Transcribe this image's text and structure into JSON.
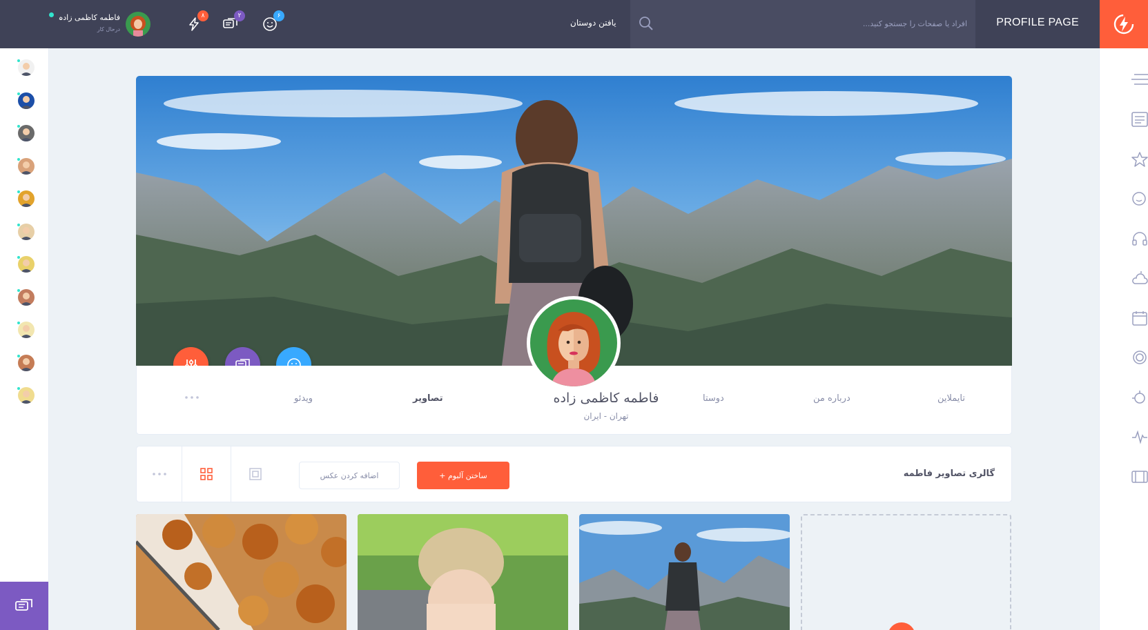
{
  "colors": {
    "topbar": "#3f4257",
    "accent": "#ff5e3a",
    "purple": "#7c5ac2",
    "blue": "#38a9ff",
    "green_online": "#32e4cd",
    "background": "#edf2f6"
  },
  "header": {
    "title": "PROFILE PAGE",
    "search_placeholder": "افراد یا صفحات را جستجو کنید...",
    "find_friends": "یافتن دوستان",
    "notifications": [
      {
        "icon": "smile-icon",
        "count": "۶"
      },
      {
        "icon": "chat-icon",
        "count": "۲"
      },
      {
        "icon": "thunder-icon",
        "count": "۸"
      }
    ],
    "user": {
      "name": "فاطمه کاظمی زاده",
      "status": "درحال کار"
    }
  },
  "profile": {
    "name": "فاطمه کاظمی زاده",
    "location": "تهران - ایران",
    "tabs_right": [
      "تایملاین",
      "درباره من",
      "دوستا"
    ],
    "tabs_left": [
      "تصاویر",
      "ویدئو"
    ],
    "active_tab": "تصاویر",
    "more": "..."
  },
  "gallery": {
    "title": "گالری تصاویر فاطمه",
    "create_album": "ساختن آلبوم +",
    "add_photo": "اضافه کردن عکس",
    "more": "..."
  },
  "left_sidebar": {
    "friends_count": 11
  },
  "right_sidebar": {
    "icons": [
      "menu-icon",
      "newsfeed-icon",
      "star-icon",
      "happy-faces-icon",
      "headphones-icon",
      "weather-icon",
      "calendar-icon",
      "badge-icon",
      "manage-widgets-icon",
      "stats-icon",
      "album-icon"
    ]
  }
}
